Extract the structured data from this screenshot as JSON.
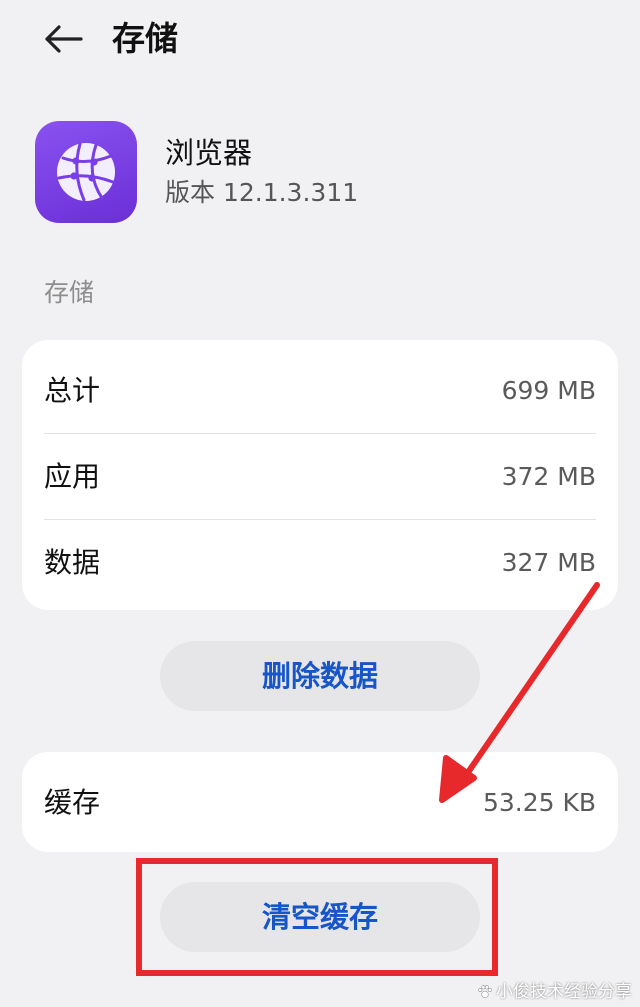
{
  "header": {
    "back_icon": "arrow-left-icon",
    "title": "存储"
  },
  "app": {
    "icon": "browser-globe-icon",
    "icon_color": "#7a3fe4",
    "name": "浏览器",
    "version": "版本 12.1.3.311"
  },
  "storage": {
    "section_title": "存储",
    "rows": [
      {
        "label": "总计",
        "value": "699 MB"
      },
      {
        "label": "应用",
        "value": "372 MB"
      },
      {
        "label": "数据",
        "value": "327 MB"
      }
    ],
    "delete_button": "删除数据"
  },
  "cache": {
    "label": "缓存",
    "value": "53.25 KB",
    "clear_button": "清空缓存"
  },
  "annotation": {
    "color": "#e8292c"
  },
  "watermark": {
    "text": "小俊技术经验分享"
  },
  "colors": {
    "background": "#f1f1f3",
    "card": "#ffffff",
    "button_bg": "#e6e6e8",
    "button_text": "#1756c9"
  }
}
